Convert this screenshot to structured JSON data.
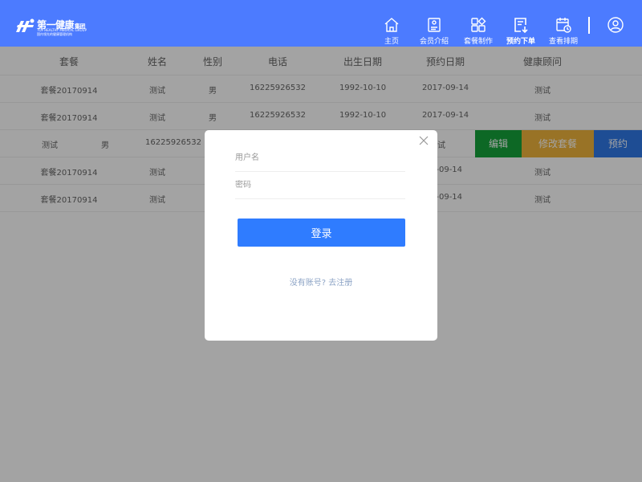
{
  "brand": {
    "name_cn": "第一健康",
    "name_suffix": "集团",
    "name_en": "TOP HEALTHY MEDICAL GROUP",
    "tagline": "国内领先的健康管理机构"
  },
  "colors": {
    "header": "#4c7bff",
    "edit": "#15a33a",
    "modify": "#f0b43c",
    "book": "#2f79e8",
    "login": "#2f7cff"
  },
  "nav": [
    {
      "label": "主页",
      "icon": "home-icon"
    },
    {
      "label": "会员介绍",
      "icon": "member-icon"
    },
    {
      "label": "套餐制作",
      "icon": "package-icon"
    },
    {
      "label": "预约下单",
      "icon": "order-icon",
      "active": true
    },
    {
      "label": "查看排期",
      "icon": "calendar-icon"
    }
  ],
  "table": {
    "headers": [
      "套餐",
      "姓名",
      "性别",
      "电话",
      "出生日期",
      "预约日期",
      "健康顾问"
    ],
    "rows": [
      {
        "package": "套餐20170914",
        "name": "测试",
        "gender": "男",
        "phone": "16225926532",
        "birth": "1992-10-10",
        "date": "2017-09-14",
        "advisor": "测试"
      },
      {
        "package": "套餐20170914",
        "name": "测试",
        "gender": "男",
        "phone": "16225926532",
        "birth": "1992-10-10",
        "date": "2017-09-14",
        "advisor": "测试"
      },
      {
        "package": "测试",
        "name": "男",
        "gender": "",
        "phone": "16225926532",
        "birth": "",
        "date": "",
        "advisor": "试"
      },
      {
        "package": "套餐20170914",
        "name": "测试",
        "gender": "",
        "phone": "",
        "birth": "",
        "date": "7-09-14",
        "advisor": "测试"
      },
      {
        "package": "套餐20170914",
        "name": "测试",
        "gender": "",
        "phone": "",
        "birth": "",
        "date": "7-09-14",
        "advisor": "测试"
      }
    ],
    "actions": {
      "edit": "编辑",
      "modify": "修改套餐",
      "book": "预约"
    }
  },
  "login": {
    "username_placeholder": "用户名",
    "password_placeholder": "密码",
    "username": "",
    "password": "",
    "submit": "登录",
    "register": "没有账号? 去注册"
  }
}
